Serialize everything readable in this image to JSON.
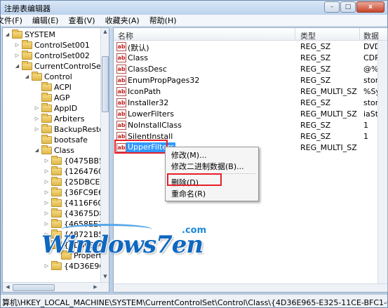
{
  "window": {
    "title": "注册表编辑器",
    "minimize": "–",
    "maximize": "□",
    "close": "x"
  },
  "menu": [
    "文件(F)",
    "编辑(E)",
    "查看(V)",
    "收藏夹(A)",
    "帮助(H)"
  ],
  "tree": [
    {
      "label": "SYSTEM",
      "indent": 0,
      "expander": "◢"
    },
    {
      "label": "ControlSet001",
      "indent": 1,
      "expander": "▷"
    },
    {
      "label": "ControlSet002",
      "indent": 1,
      "expander": "▷"
    },
    {
      "label": "CurrentControlSet",
      "indent": 1,
      "expander": "◢"
    },
    {
      "label": "Control",
      "indent": 2,
      "expander": "◢"
    },
    {
      "label": "ACPI",
      "indent": 3,
      "expander": ""
    },
    {
      "label": "AGP",
      "indent": 3,
      "expander": ""
    },
    {
      "label": "AppID",
      "indent": 3,
      "expander": "▷"
    },
    {
      "label": "Arbiters",
      "indent": 3,
      "expander": "▷"
    },
    {
      "label": "BackupRestore",
      "indent": 3,
      "expander": "▷"
    },
    {
      "label": "bootsafe",
      "indent": 3,
      "expander": ""
    },
    {
      "label": "Class",
      "indent": 3,
      "expander": "◢"
    },
    {
      "label": "{0475BB51-5",
      "indent": 4,
      "expander": "▷"
    },
    {
      "label": "{1264760F-A",
      "indent": 4,
      "expander": "▷"
    },
    {
      "label": "{25DBCE51-6",
      "indent": 4,
      "expander": "▷"
    },
    {
      "label": "{36FC9E60-C",
      "indent": 4,
      "expander": "▷"
    },
    {
      "label": "{4116F60B-2",
      "indent": 4,
      "expander": "▷"
    },
    {
      "label": "{43675D81-5",
      "indent": 4,
      "expander": "▷"
    },
    {
      "label": "{4658EE7E-F",
      "indent": 4,
      "expander": "▷"
    },
    {
      "label": "{48721B56-6",
      "indent": 4,
      "expander": "▷"
    },
    {
      "label": "{4D36E965-E",
      "indent": 4,
      "expander": "◢"
    },
    {
      "label": "Propertie",
      "indent": 5,
      "expander": ""
    },
    {
      "label": "{4D36E966-E",
      "indent": 4,
      "expander": "▷"
    }
  ],
  "columns": {
    "name": "名称",
    "type": "类型",
    "data": "数据"
  },
  "values": [
    {
      "icon": "ab",
      "name": "(默认)",
      "type": "REG_SZ",
      "data": "DVD/C"
    },
    {
      "icon": "ab",
      "name": "Class",
      "type": "REG_SZ",
      "data": "CDRON"
    },
    {
      "icon": "ab",
      "name": "ClassDesc",
      "type": "REG_SZ",
      "data": "@%Sys"
    },
    {
      "icon": "ab",
      "name": "EnumPropPages32",
      "type": "REG_SZ",
      "data": "storpro"
    },
    {
      "icon": "ab",
      "name": "IconPath",
      "type": "REG_MULTI_SZ",
      "data": "%Syste"
    },
    {
      "icon": "ab",
      "name": "Installer32",
      "type": "REG_SZ",
      "data": "storpro"
    },
    {
      "icon": "ab",
      "name": "LowerFilters",
      "type": "REG_MULTI_SZ",
      "data": "iaStorF"
    },
    {
      "icon": "ab",
      "name": "NoInstallClass",
      "type": "REG_SZ",
      "data": "1"
    },
    {
      "icon": "ab",
      "name": "SilentInstall",
      "type": "REG_SZ",
      "data": "1"
    },
    {
      "icon": "ab",
      "name": "UpperFilters",
      "type": "REG_MULTI_SZ",
      "data": ""
    }
  ],
  "context_menu": {
    "modify": "修改(M)...",
    "modify_binary": "修改二进制数据(B)...",
    "delete": "删除(D)",
    "rename": "重命名(R)"
  },
  "watermark": {
    "text": "Windows7en",
    "suffix": ".com"
  },
  "status": "算机\\HKEY_LOCAL_MACHINE\\SYSTEM\\CurrentControlSet\\Control\\Class\\{4D36E965-E325-11CE-BFC1-08002BE10318}"
}
